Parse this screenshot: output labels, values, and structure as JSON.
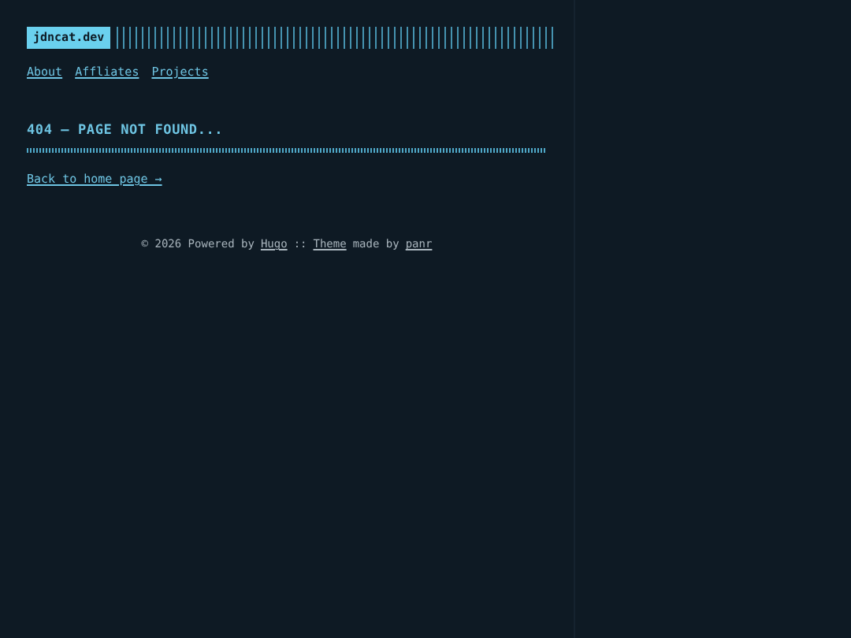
{
  "logo": "jdncat.dev",
  "menu": [
    {
      "label": "About"
    },
    {
      "label": "Affliates"
    },
    {
      "label": "Projects"
    }
  ],
  "title": "404 — PAGE NOT FOUND...",
  "back_link": "Back to home page →",
  "footer": {
    "copyright": "© 2026 Powered by",
    "hugo": "Hugo",
    "separator": "::",
    "theme": "Theme",
    "made_by": "made by",
    "author": "panr"
  }
}
